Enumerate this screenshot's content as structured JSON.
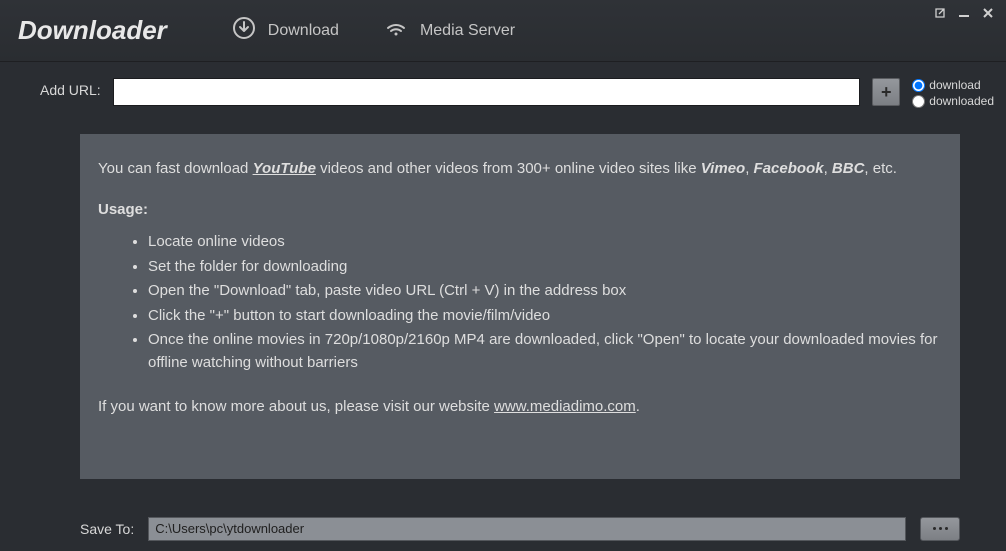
{
  "titlebar": {
    "app_title": "Downloader",
    "tabs": [
      {
        "label": "Download"
      },
      {
        "label": "Media Server"
      }
    ]
  },
  "url_bar": {
    "label": "Add URL:",
    "value": "",
    "add_label": "+",
    "radio_download": "download",
    "radio_downloaded": "downloaded"
  },
  "content": {
    "intro_pre": "You can fast download ",
    "intro_youtube": "YouTube",
    "intro_mid": " videos and other videos from 300+ online video sites like ",
    "site_vimeo": "Vimeo",
    "sep1": ", ",
    "site_facebook": "Facebook",
    "sep2": ", ",
    "site_bbc": "BBC",
    "intro_post": ", etc.",
    "usage_heading": "Usage:",
    "usage": [
      "Locate online videos",
      "Set the folder for downloading",
      "Open the \"Download\" tab, paste video URL (Ctrl + V) in the address box",
      "Click the \"+\" button to start downloading the movie/film/video",
      "Once the online movies in 720p/1080p/2160p MP4 are downloaded, click \"Open\" to locate your downloaded movies for offline watching without barriers"
    ],
    "more_pre": "If you want to know more about us, please visit our website ",
    "more_link": "www.mediadimo.com",
    "more_post": "."
  },
  "save_bar": {
    "label": "Save To:",
    "path": "C:\\Users\\pc\\ytdownloader"
  }
}
